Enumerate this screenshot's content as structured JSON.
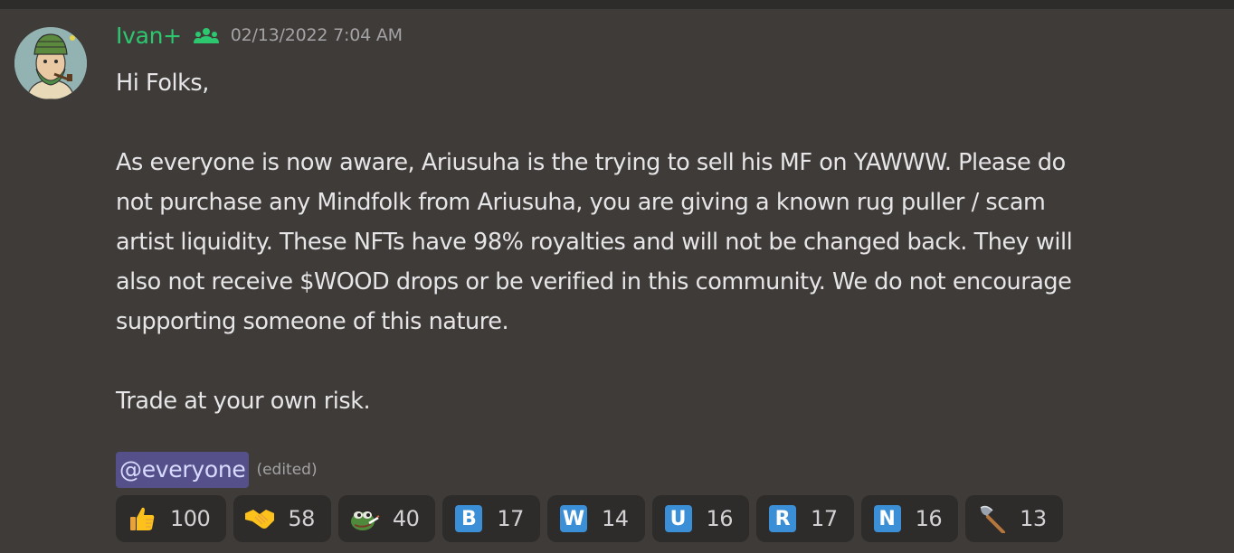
{
  "message": {
    "username": "Ivan+",
    "timestamp": "02/13/2022 7:04 AM",
    "lines": [
      "Hi Folks,",
      "",
      "As everyone is now aware, Ariusuha is the trying to sell his MF on YAWWW. Please do",
      "not purchase any Mindfolk from Ariusuha, you are giving a known rug puller / scam",
      "artist liquidity. These NFTs have 98% royalties and will not be changed back. They will",
      "also not receive $WOOD drops or be verified in this community. We do not encourage",
      "supporting someone of this nature.",
      "",
      "Trade at your own risk."
    ],
    "mention": "@everyone",
    "edited": "(edited)"
  },
  "colors": {
    "username": "#2dc770",
    "mention_bg": "#55508a",
    "reaction_bg": "#2e2c2a",
    "letter_emoji_bg": "#3b8fd6"
  },
  "reactions": [
    {
      "emoji": "thumbs-up-icon",
      "count": "100"
    },
    {
      "emoji": "handshake-icon",
      "count": "58"
    },
    {
      "emoji": "pepe-custom-emoji",
      "count": "40"
    },
    {
      "emoji": "letter-b-icon",
      "letter": "B",
      "count": "17"
    },
    {
      "emoji": "letter-w-icon",
      "letter": "W",
      "count": "14"
    },
    {
      "emoji": "letter-u-icon",
      "letter": "U",
      "count": "16"
    },
    {
      "emoji": "letter-r-icon",
      "letter": "R",
      "count": "17"
    },
    {
      "emoji": "letter-n-icon",
      "letter": "N",
      "count": "16"
    },
    {
      "emoji": "axe-icon",
      "count": "13"
    }
  ]
}
